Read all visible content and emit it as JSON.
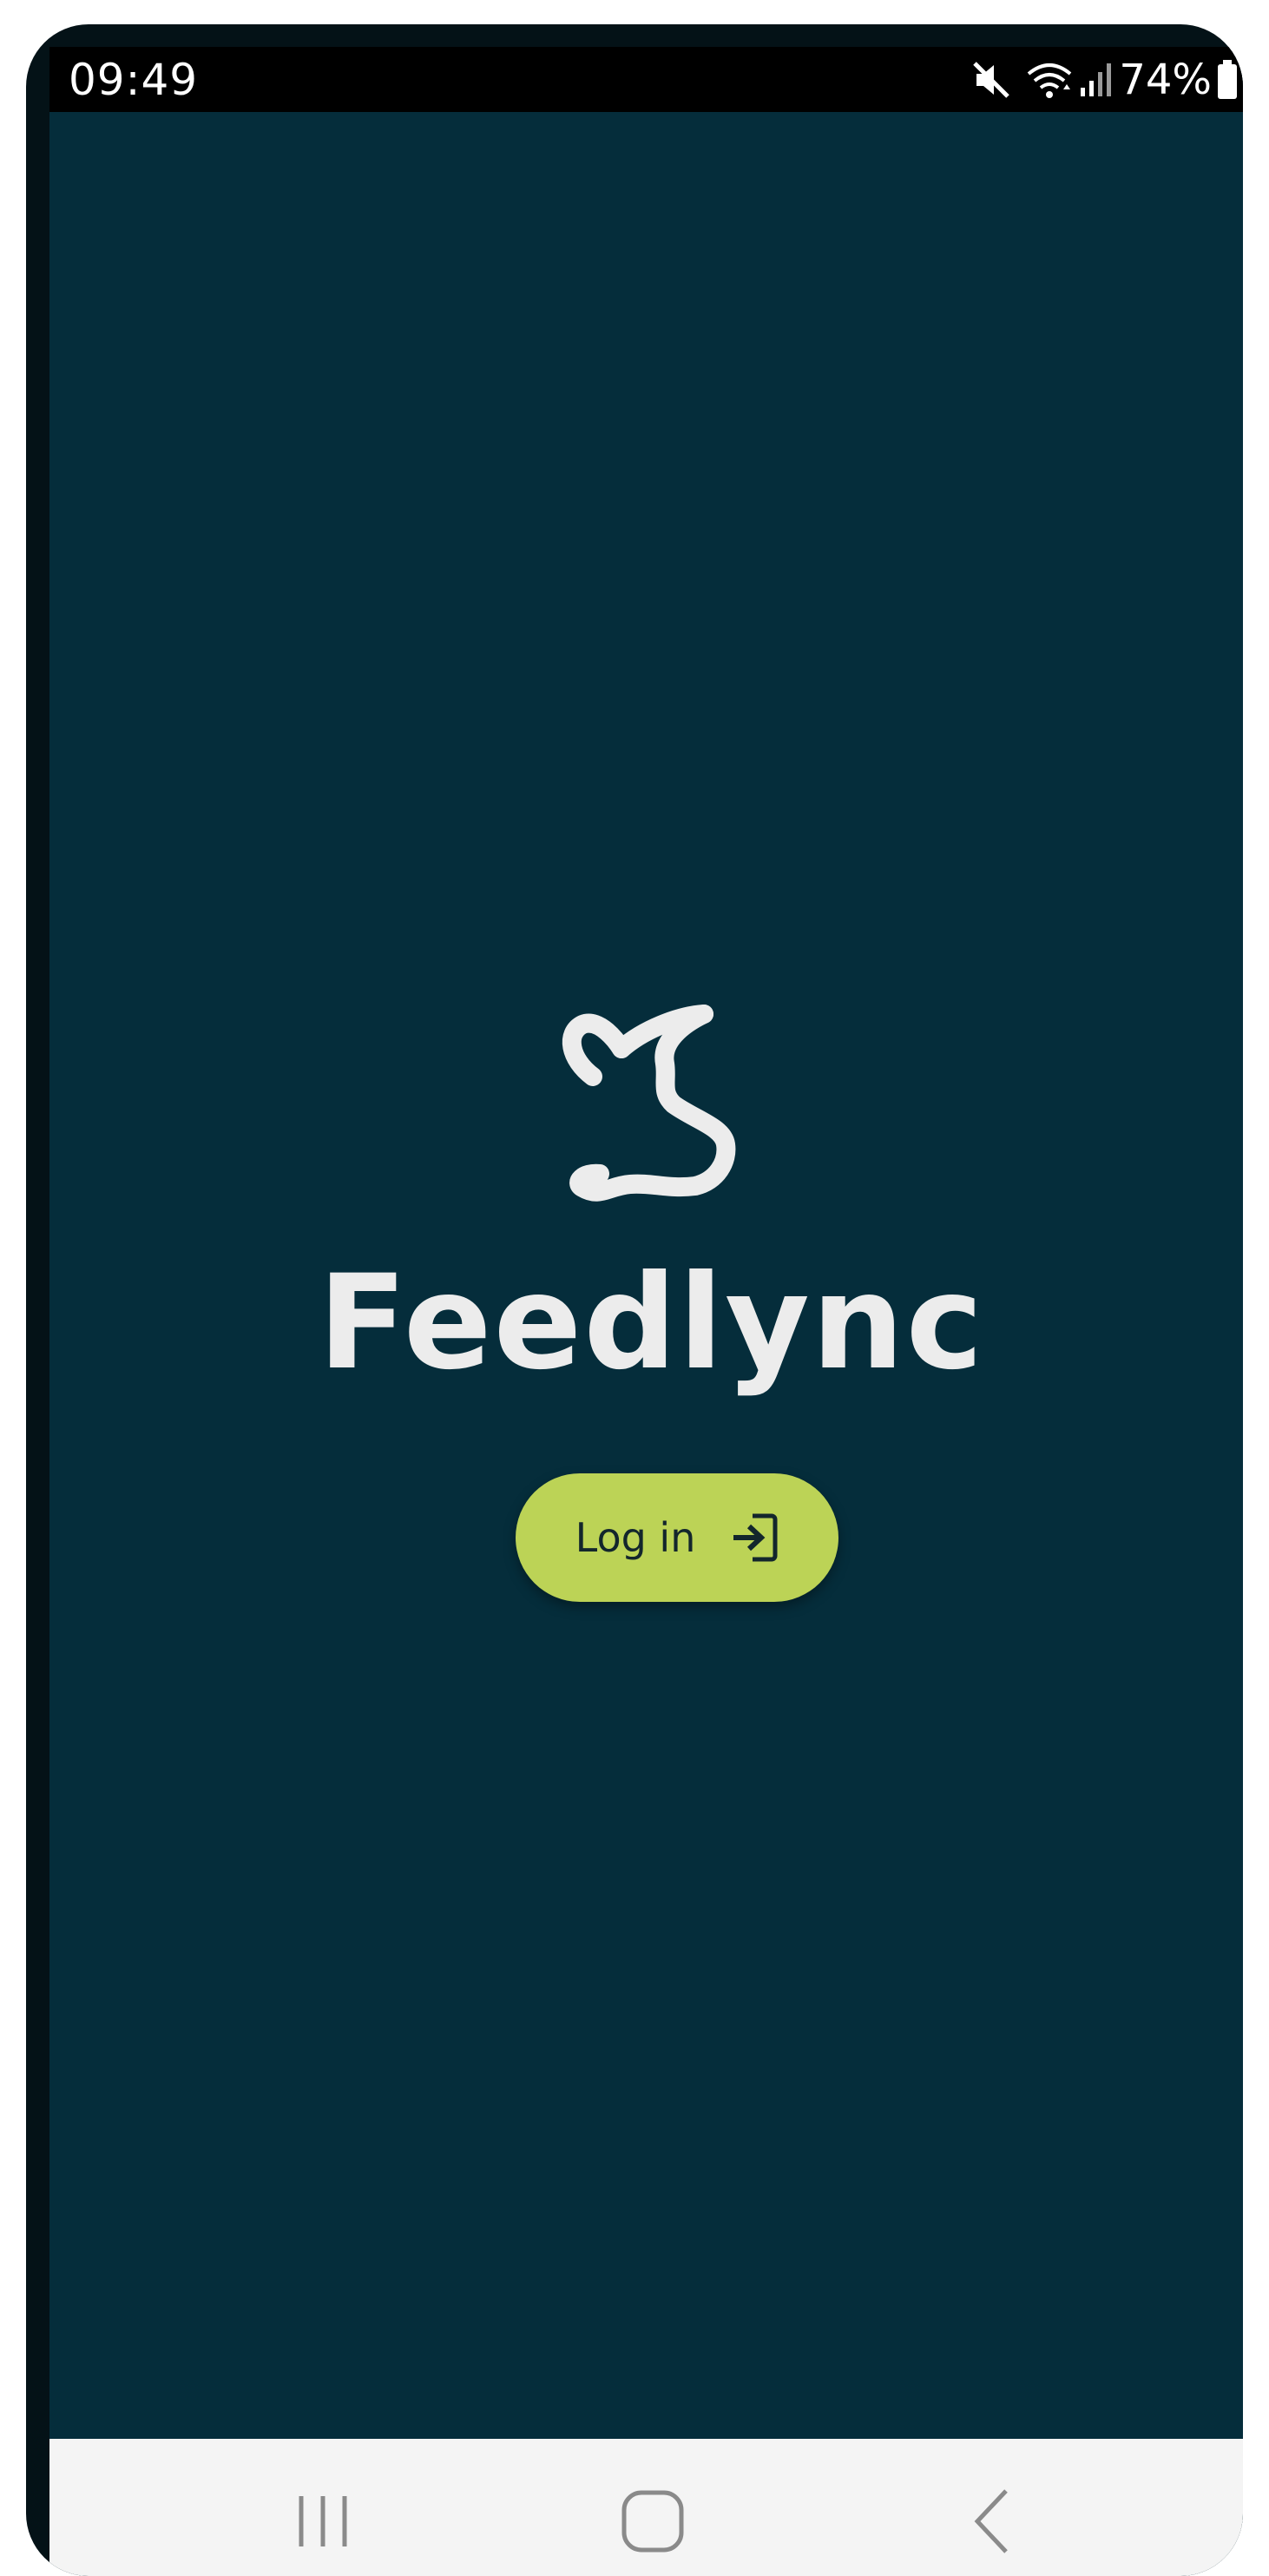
{
  "status_bar": {
    "time": "09:49",
    "battery_percent": "74%",
    "icons": [
      "mute-icon",
      "wifi-icon",
      "signal-icon",
      "battery-icon"
    ]
  },
  "brand": {
    "logo": "cow-head-logo",
    "name": "Feedlync"
  },
  "login": {
    "label": "Log in",
    "icon": "login-icon"
  },
  "nav_bar": {
    "buttons": [
      "recents-icon",
      "home-icon",
      "back-icon"
    ]
  },
  "colors": {
    "background": "#052d3b",
    "accent": "#bcd356",
    "text_light": "#ececec",
    "nav_bar": "#f4f4f4"
  }
}
